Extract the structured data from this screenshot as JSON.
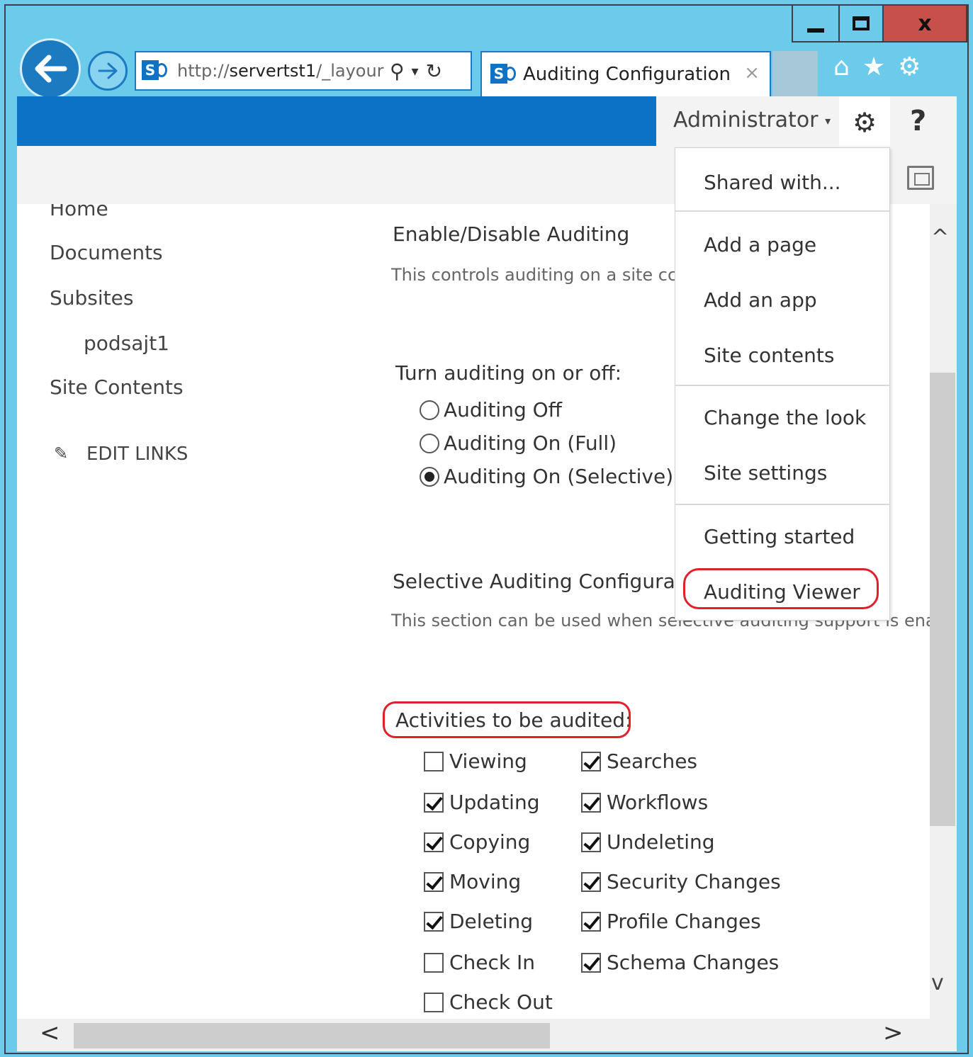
{
  "browser": {
    "url_prefix": "http://",
    "url_host": "servertst1",
    "url_path": "/_layour",
    "tab_title": "Auditing Configuration",
    "tab_close": "×",
    "search_glyph": "⚲",
    "dropdown_glyph": "▾",
    "refresh_glyph": "↻",
    "home_glyph": "⌂",
    "star_glyph": "★",
    "tools_glyph": "⚙",
    "min_glyph": "",
    "close_glyph": "x"
  },
  "header": {
    "user": "Administrator",
    "user_caret": "▾",
    "gear_glyph": "⚙",
    "help": "?"
  },
  "left_nav": {
    "items": [
      "Home",
      "Documents",
      "Subsites",
      "podsajt1",
      "Site Contents"
    ],
    "edit_links": "EDIT LINKS",
    "pencil_glyph": "✎"
  },
  "main": {
    "section1_title": "Enable/Disable Auditing",
    "section1_desc": "This controls auditing on a site cc",
    "toggle_label": "Turn auditing on or off:",
    "radios": [
      {
        "label": "Auditing Off",
        "checked": false
      },
      {
        "label": "Auditing On (Full)",
        "checked": false
      },
      {
        "label": "Auditing On (Selective)",
        "checked": true
      }
    ],
    "section2_title": "Selective Auditing Configuratic",
    "section2_desc": "This section can be used when selective auditing support is ena",
    "activities_label": "Activities to be audited:",
    "checks_left": [
      {
        "label": "Viewing",
        "checked": false
      },
      {
        "label": "Updating",
        "checked": true
      },
      {
        "label": "Copying",
        "checked": true
      },
      {
        "label": "Moving",
        "checked": true
      },
      {
        "label": "Deleting",
        "checked": true
      },
      {
        "label": "Check In",
        "checked": false
      },
      {
        "label": "Check Out",
        "checked": false
      }
    ],
    "checks_right": [
      {
        "label": "Searches",
        "checked": true
      },
      {
        "label": "Workflows",
        "checked": true
      },
      {
        "label": "Undeleting",
        "checked": true
      },
      {
        "label": "Security Changes",
        "checked": true
      },
      {
        "label": "Profile Changes",
        "checked": true
      },
      {
        "label": "Schema Changes",
        "checked": true
      }
    ]
  },
  "settings_menu": {
    "items": [
      "Shared with...",
      "Add a page",
      "Add an app",
      "Site contents",
      "Change the look",
      "Site settings",
      "Getting started",
      "Auditing Viewer"
    ]
  },
  "scroll": {
    "up": "^",
    "down": "v",
    "left": "<",
    "right": ">"
  },
  "colors": {
    "frame": "#6ccaea",
    "suite_bar": "#0c72c5",
    "highlight": "#e0202a",
    "close_btn": "#c8504a"
  }
}
